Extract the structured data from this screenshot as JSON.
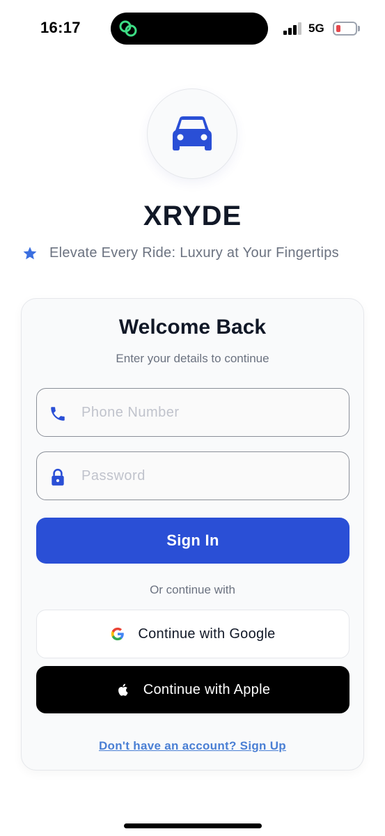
{
  "status_bar": {
    "time": "16:17",
    "network": "5G",
    "signal_icon": "signal-bars-icon",
    "battery_icon": "battery-low-icon",
    "island_icon": "linked-rings-icon",
    "island_icon_color": "#3ddc84"
  },
  "brand": {
    "logo_icon": "car-icon",
    "name": "XRYDE",
    "tagline_icon": "star-icon",
    "tagline": "Elevate Every Ride: Luxury at Your Fingertips"
  },
  "login_card": {
    "title": "Welcome Back",
    "subtitle": "Enter your details to continue",
    "phone_field": {
      "icon": "phone-icon",
      "value": "",
      "placeholder": "Phone Number"
    },
    "password_field": {
      "icon": "lock-icon",
      "value": "",
      "placeholder": "Password"
    },
    "sign_in_label": "Sign In",
    "divider_text": "Or continue with",
    "google_button": {
      "icon": "google-icon",
      "label": "Continue with Google"
    },
    "apple_button": {
      "icon": "apple-icon",
      "label": "Continue with Apple"
    },
    "signup_link": "Don't have an account? Sign Up"
  },
  "colors": {
    "accent": "#2a4fd6",
    "star": "#3b6fe0",
    "link": "#4a7fd4",
    "text": "#111827",
    "muted": "#6b7280",
    "battery_low": "#e5484d"
  }
}
